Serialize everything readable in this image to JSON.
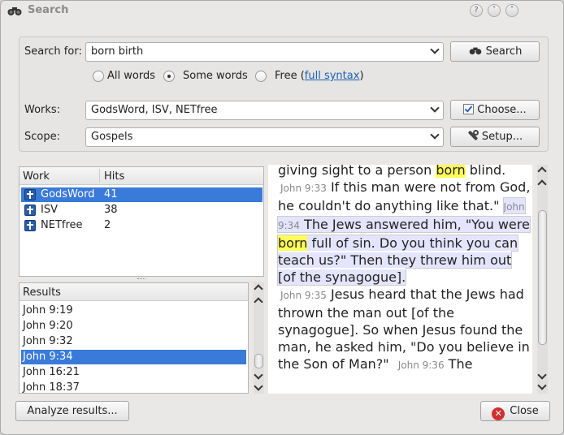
{
  "window": {
    "title": "Search"
  },
  "search": {
    "label": "Search for:",
    "value": "born birth",
    "button": "Search",
    "options": {
      "all": "All words",
      "some": "Some words",
      "free": "Free (",
      "syntax_link": "full syntax",
      "free_end": ")"
    },
    "selected_option": "some"
  },
  "works": {
    "label": "Works:",
    "value": "GodsWord, ISV, NETfree",
    "choose_button": "Choose..."
  },
  "scope": {
    "label": "Scope:",
    "value": "Gospels",
    "setup_button": "Setup..."
  },
  "works_table": {
    "columns": [
      "Work",
      "Hits"
    ],
    "rows": [
      {
        "work": "GodsWord",
        "hits": "41",
        "selected": true
      },
      {
        "work": "ISV",
        "hits": "38",
        "selected": false
      },
      {
        "work": "NETfree",
        "hits": "2",
        "selected": false
      }
    ]
  },
  "results": {
    "header": "Results",
    "items": [
      "John 9:19",
      "John 9:20",
      "John 9:32",
      "John 9:34",
      "John 16:21",
      "John 18:37"
    ],
    "selected_index": 3
  },
  "reader": {
    "line0_pre": "giving sight to a person ",
    "line0_hl": "born",
    "line0_post": " blind.",
    "v33": "John 9:33",
    "t33": " If this man were not from God, he couldn't do anything like that.\"",
    "v34": "John 9:34",
    "t34_pre": " The Jews answered him, \"You were ",
    "t34_hl": "born",
    "t34_post": " full of sin. Do you think you can teach us?\" Then they threw him out [of the synagogue].",
    "v35": "John 9:35",
    "t35": " Jesus heard that the Jews had thrown the man out [of the synagogue]. So when Jesus found the man, he asked him, \"Do you believe in the Son of Man?\"",
    "v36": "John 9:36",
    "t36": " The"
  },
  "footer": {
    "analyze_button": "Analyze results...",
    "close_button": "Close"
  }
}
